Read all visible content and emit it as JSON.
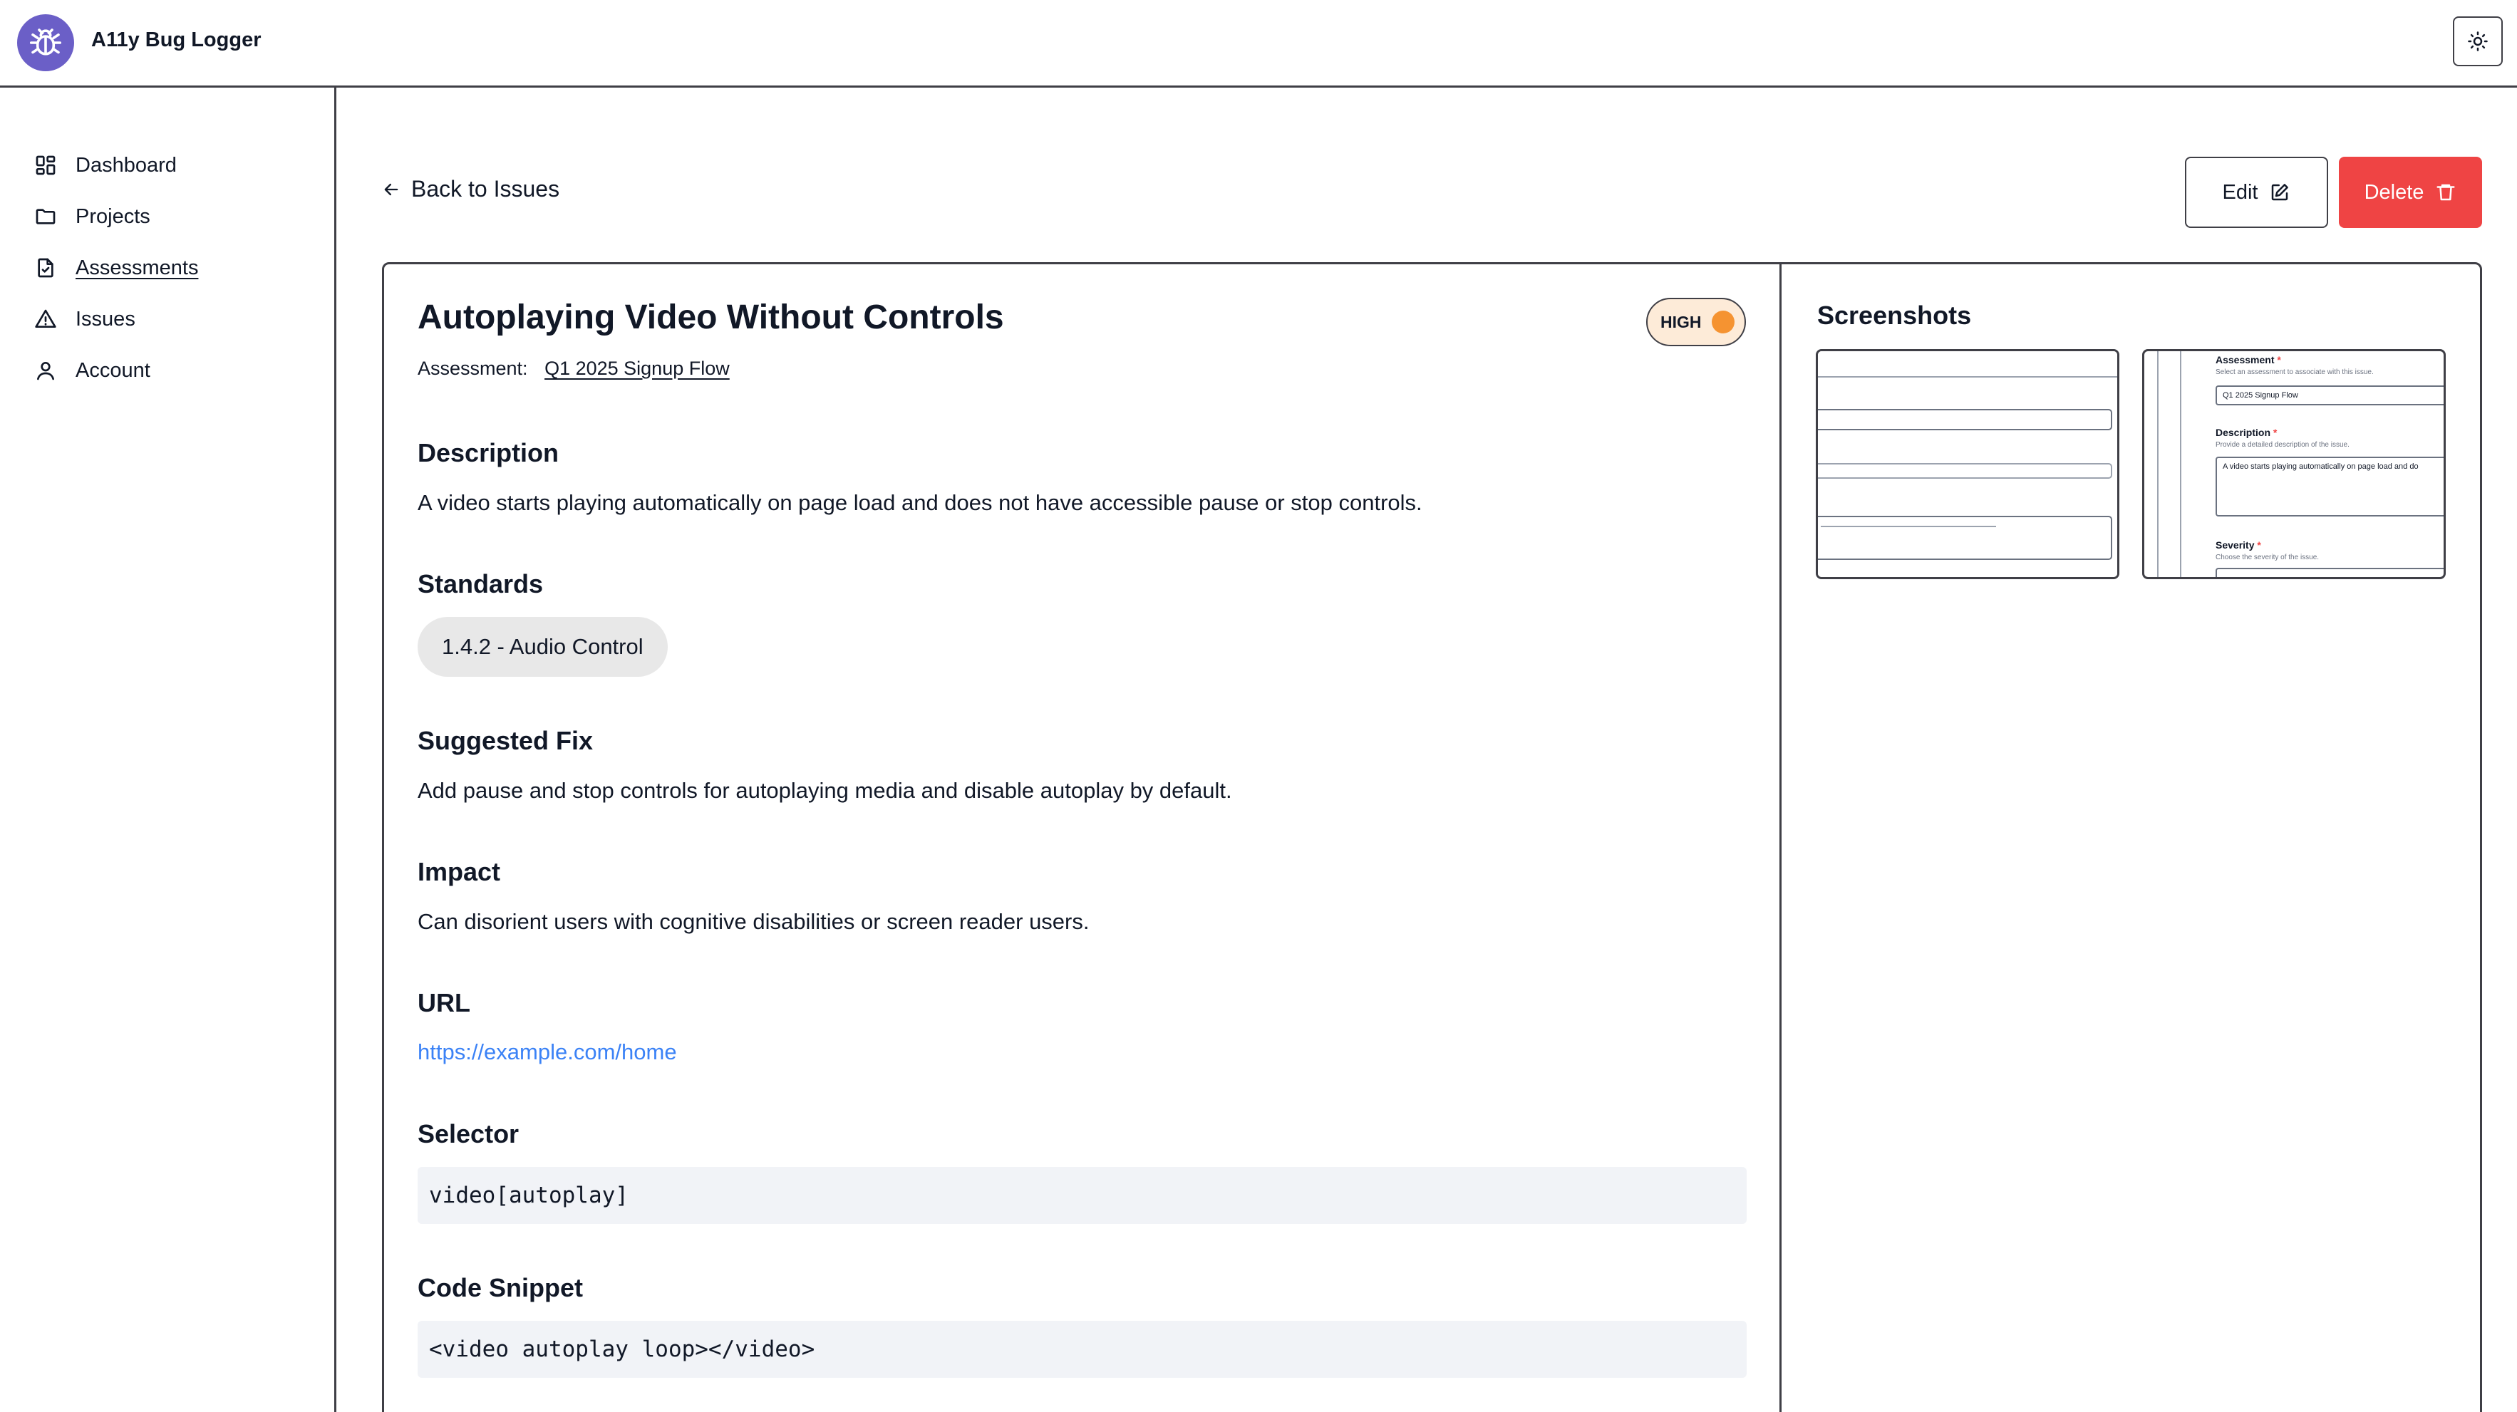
{
  "app": {
    "title": "A11y Bug Logger"
  },
  "sidebar": {
    "items": [
      {
        "label": "Dashboard",
        "icon": "dashboard-icon"
      },
      {
        "label": "Projects",
        "icon": "folder-icon"
      },
      {
        "label": "Assessments",
        "icon": "file-check-icon"
      },
      {
        "label": "Issues",
        "icon": "warning-icon"
      },
      {
        "label": "Account",
        "icon": "user-icon"
      }
    ]
  },
  "toolbar": {
    "back_label": "Back to Issues",
    "edit_label": "Edit",
    "delete_label": "Delete"
  },
  "issue": {
    "title": "Autoplaying Video Without Controls",
    "severity": "HIGH",
    "assessment_label": "Assessment:",
    "assessment_name": "Q1 2025 Signup Flow",
    "sections": {
      "description_h": "Description",
      "description": "A video starts playing automatically on page load and does not have accessible pause or stop controls.",
      "standards_h": "Standards",
      "standard": "1.4.2 - Audio Control",
      "fix_h": "Suggested Fix",
      "fix": "Add pause and stop controls for autoplaying media and disable autoplay by default.",
      "impact_h": "Impact",
      "impact": "Can disorient users with cognitive disabilities or screen reader users.",
      "url_h": "URL",
      "url": "https://example.com/home",
      "selector_h": "Selector",
      "selector": "video[autoplay]",
      "snippet_h": "Code Snippet",
      "snippet": "<video autoplay loop></video>"
    }
  },
  "screenshots": {
    "heading": "Screenshots",
    "thumb2": {
      "assessment_label": "Assessment",
      "assessment_hint": "Select an assessment to associate with this issue.",
      "assessment_value": "Q1 2025 Signup Flow",
      "description_label": "Description",
      "description_hint": "Provide a detailed description of the issue.",
      "description_value": "A video starts playing automatically on page load and do",
      "severity_label": "Severity",
      "severity_hint": "Choose the severity of the issue."
    }
  },
  "colors": {
    "accent": "#6b5fc7",
    "danger": "#ef4444",
    "severity_high": "#f59331",
    "link": "#3b82f6"
  }
}
